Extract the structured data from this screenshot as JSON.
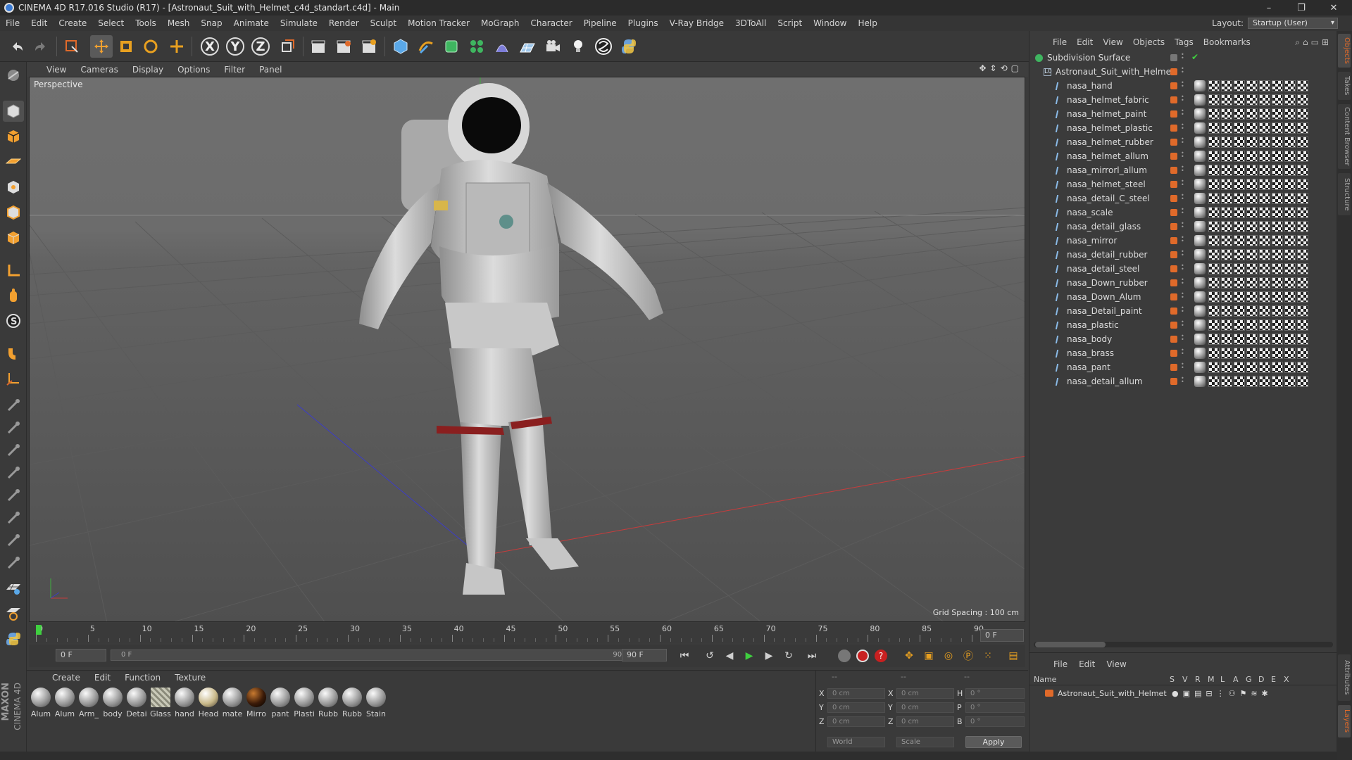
{
  "window": {
    "title": "CINEMA 4D R17.016 Studio (R17) - [Astronaut_Suit_with_Helmet_c4d_standart.c4d] - Main",
    "minimize": "–",
    "maximize": "❐",
    "close": "✕"
  },
  "menubar": {
    "items": [
      "File",
      "Edit",
      "Create",
      "Select",
      "Tools",
      "Mesh",
      "Snap",
      "Animate",
      "Simulate",
      "Render",
      "Sculpt",
      "Motion Tracker",
      "MoGraph",
      "Character",
      "Pipeline",
      "Plugins",
      "V-Ray Bridge",
      "3DToAll",
      "Script",
      "Window",
      "Help"
    ]
  },
  "layout": {
    "label": "Layout:",
    "value": "Startup (User)"
  },
  "toolbar": {
    "axis_x": "X",
    "axis_y": "Y",
    "axis_z": "Z"
  },
  "viewport": {
    "menu": [
      "View",
      "Cameras",
      "Display",
      "Options",
      "Filter",
      "Panel"
    ],
    "label": "Perspective",
    "grid_spacing": "Grid Spacing : 100 cm"
  },
  "timeline": {
    "ticks": [
      "0",
      "5",
      "10",
      "15",
      "20",
      "25",
      "30",
      "35",
      "40",
      "45",
      "50",
      "55",
      "60",
      "65",
      "70",
      "75",
      "80",
      "85",
      "90"
    ],
    "current_frame": "0 F",
    "start_field": "0 F",
    "range_start": "0 F",
    "range_end": "90 F",
    "end_field": "90 F"
  },
  "material_manager": {
    "menu": [
      "Create",
      "Edit",
      "Function",
      "Texture"
    ],
    "materials": [
      "Alum",
      "Alum",
      "Arm_",
      "body",
      "Detai",
      "Glass",
      "hand",
      "Head",
      "mate",
      "Mirro",
      "pant",
      "Plasti",
      "Rubb",
      "Rubb",
      "Stain"
    ]
  },
  "coordinates": {
    "header": [
      "--",
      "--",
      "--"
    ],
    "rows": [
      {
        "axis": "X",
        "pos": "0 cm",
        "size_axis": "X",
        "size": "0 cm",
        "rot_axis": "H",
        "rot": "0 °"
      },
      {
        "axis": "Y",
        "pos": "0 cm",
        "size_axis": "Y",
        "size": "0 cm",
        "rot_axis": "P",
        "rot": "0 °"
      },
      {
        "axis": "Z",
        "pos": "0 cm",
        "size_axis": "Z",
        "size": "0 cm",
        "rot_axis": "B",
        "rot": "0 °"
      }
    ],
    "mode": "World",
    "type": "Scale",
    "apply": "Apply"
  },
  "object_manager": {
    "menu": [
      "File",
      "Edit",
      "View",
      "Objects",
      "Tags",
      "Bookmarks"
    ],
    "root": "Subdivision Surface",
    "group": "Astronaut_Suit_with_Helmet",
    "objects": [
      "nasa_hand",
      "nasa_helmet_fabric",
      "nasa_helmet_paint",
      "nasa_helmet_plastic",
      "nasa_helmet_rubber",
      "nasa_helmet_allum",
      "nasa_mirrorl_allum",
      "nasa_helmet_steel",
      "nasa_detail_C_steel",
      "nasa_scale",
      "nasa_detail_glass",
      "nasa_mirror",
      "nasa_detail_rubber",
      "nasa_detail_steel",
      "nasa_Down_rubber",
      "nasa_Down_Alum",
      "nasa_Detail_paint",
      "nasa_plastic",
      "nasa_body",
      "nasa_brass",
      "nasa_pant",
      "nasa_detail_allum"
    ]
  },
  "layer_manager": {
    "menu": [
      "File",
      "Edit",
      "View"
    ],
    "col_name": "Name",
    "cols": [
      "S",
      "V",
      "R",
      "M",
      "L",
      "A",
      "G",
      "D",
      "E",
      "X"
    ],
    "layer": "Astronaut_Suit_with_Helmet"
  },
  "right_tabs": [
    "Objects",
    "Takes",
    "Content Browser",
    "Structure",
    "Attributes",
    "Layers"
  ],
  "brand": {
    "line1": "MAXON",
    "line2": "CINEMA 4D"
  }
}
